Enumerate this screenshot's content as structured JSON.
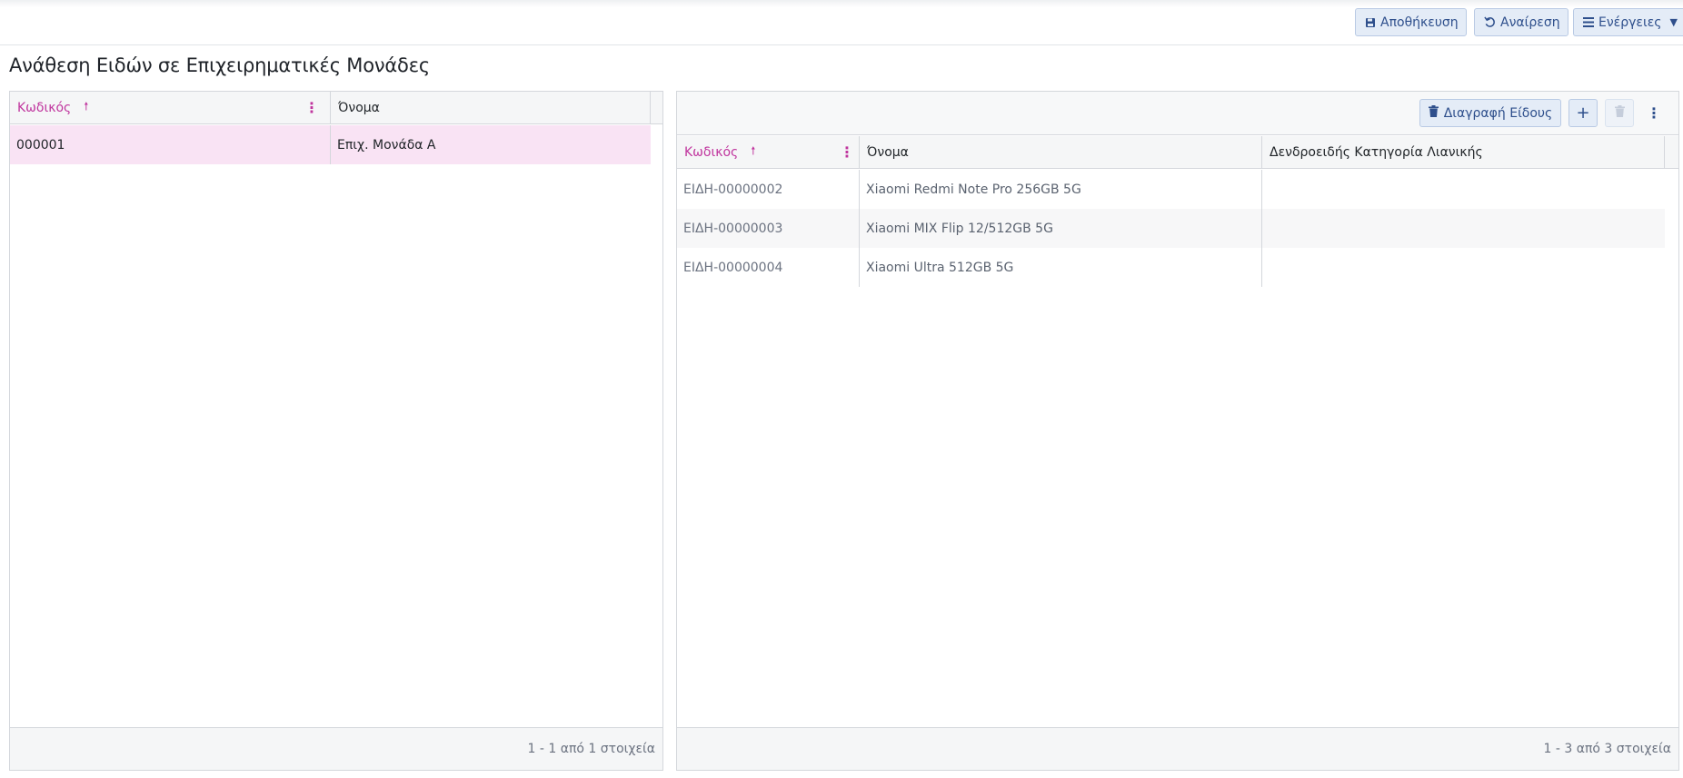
{
  "toolbar": {
    "save_label": "Αποθήκευση",
    "undo_label": "Αναίρεση",
    "actions_label": "Ενέργειες"
  },
  "page": {
    "title": "Ανάθεση Ειδών σε Επιχειρηματικές Μονάδες"
  },
  "left_grid": {
    "columns": [
      "Κωδικός",
      "Όνομα"
    ],
    "rows": [
      {
        "code": "000001",
        "name": "Επιχ. Μονάδα Α"
      }
    ],
    "footer": "1 - 1 από 1 στοιχεία"
  },
  "right_grid": {
    "delete_item_label": "Διαγραφή Είδους",
    "columns": [
      "Κωδικός",
      "Όνομα",
      "Δενδροειδής Κατηγορία Λιανικής"
    ],
    "rows": [
      {
        "code": "ΕΙΔΗ-00000002",
        "name": "Xiaomi Redmi Note Pro 256GB 5G",
        "category": ""
      },
      {
        "code": "ΕΙΔΗ-00000003",
        "name": "Xiaomi MIX Flip 12/512GB 5G",
        "category": ""
      },
      {
        "code": "ΕΙΔΗ-00000004",
        "name": "Xiaomi Ultra 512GB 5G",
        "category": ""
      }
    ],
    "footer": "1 - 3 από 3 στοιχεία"
  },
  "colors": {
    "accent": "#c0359e",
    "button_text": "#2e4f8c",
    "selected_row": "#f9e3f4"
  }
}
